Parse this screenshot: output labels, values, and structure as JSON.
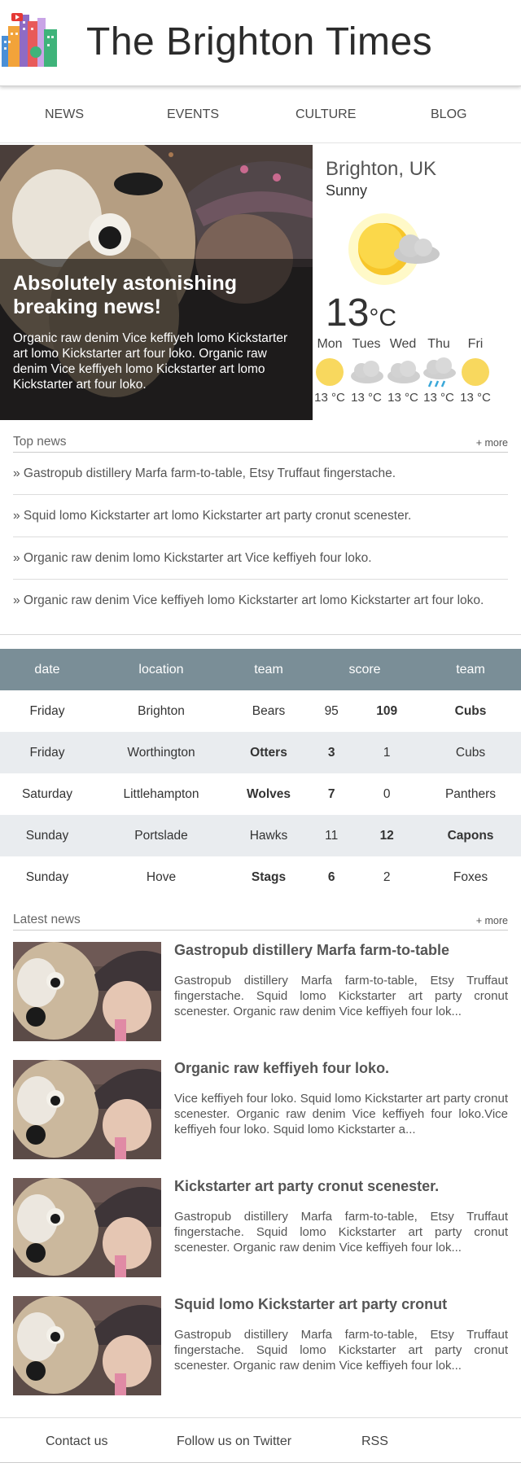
{
  "site": {
    "title": "The Brighton Times"
  },
  "nav": {
    "items": [
      "NEWS",
      "EVENTS",
      "CULTURE",
      "BLOG"
    ]
  },
  "hero": {
    "title": "Absolutely astonishing breaking news!",
    "text": "Organic raw denim Vice keffiyeh lomo Kickstarter art lomo Kickstarter art four loko. Organic raw denim Vice keffiyeh lomo Kickstarter art lomo Kickstarter art four loko."
  },
  "weather": {
    "location": "Brighton, UK",
    "condition": "Sunny",
    "temp": "13",
    "unit": "°C",
    "main_icon": "sun-cloud-icon",
    "forecast": [
      {
        "day": "Mon",
        "icon": "sun-icon",
        "temp": "13 °C"
      },
      {
        "day": "Tues",
        "icon": "cloud-icon",
        "temp": "13 °C"
      },
      {
        "day": "Wed",
        "icon": "cloud-icon",
        "temp": "13 °C"
      },
      {
        "day": "Thu",
        "icon": "rain-icon",
        "temp": "13 °C"
      },
      {
        "day": "Fri",
        "icon": "sun-icon",
        "temp": "13 °C"
      }
    ]
  },
  "top_news": {
    "title": "Top news",
    "more": "+ more",
    "items": [
      "» Gastropub distillery Marfa farm-to-table, Etsy Truffaut fingerstache.",
      "» Squid lomo Kickstarter art lomo Kickstarter art party cronut scenester.",
      "» Organic raw denim lomo Kickstarter art Vice keffiyeh four loko.",
      "» Organic raw denim Vice keffiyeh lomo Kickstarter art lomo Kickstarter art four loko."
    ]
  },
  "scores": {
    "headers": [
      "date",
      "location",
      "team",
      "score",
      "team"
    ],
    "rows": [
      {
        "date": "Friday",
        "location": "Brighton",
        "team1": "Bears",
        "score1": "95",
        "score2": "109",
        "team2": "Cubs",
        "winner": 2
      },
      {
        "date": "Friday",
        "location": "Worthington",
        "team1": "Otters",
        "score1": "3",
        "score2": "1",
        "team2": "Cubs",
        "winner": 1
      },
      {
        "date": "Saturday",
        "location": "Littlehampton",
        "team1": "Wolves",
        "score1": "7",
        "score2": "0",
        "team2": "Panthers",
        "winner": 1
      },
      {
        "date": "Sunday",
        "location": "Portslade",
        "team1": "Hawks",
        "score1": "11",
        "score2": "12",
        "team2": "Capons",
        "winner": 2
      },
      {
        "date": "Sunday",
        "location": "Hove",
        "team1": "Stags",
        "score1": "6",
        "score2": "2",
        "team2": "Foxes",
        "winner": 1
      }
    ]
  },
  "latest_news": {
    "title": "Latest news",
    "more": "+ more",
    "items": [
      {
        "title": "Gastropub distillery Marfa farm-to-table",
        "text": "Gastropub distillery Marfa farm-to-table, Etsy Truffaut fingerstache. Squid lomo Kickstarter art party cronut scenester. Organic raw denim Vice keffiyeh four lok..."
      },
      {
        "title": "Organic raw keffiyeh four loko.",
        "text": "Vice keffiyeh four loko. Squid lomo Kickstarter art party cronut scenester. Organic raw denim Vice keffiyeh four loko.Vice keffiyeh four loko. Squid lomo Kickstarter a..."
      },
      {
        "title": "Kickstarter art party cronut scenester.",
        "text": "Gastropub distillery Marfa farm-to-table, Etsy Truffaut fingerstache. Squid lomo Kickstarter art party cronut scenester. Organic raw denim Vice keffiyeh four lok..."
      },
      {
        "title": "Squid lomo Kickstarter art party cronut",
        "text": "Gastropub distillery Marfa farm-to-table, Etsy Truffaut fingerstache. Squid lomo Kickstarter art party cronut scenester. Organic raw denim Vice keffiyeh four lok..."
      }
    ]
  },
  "footer": {
    "links": [
      "Contact us",
      "Follow us on Twitter",
      "RSS"
    ]
  }
}
